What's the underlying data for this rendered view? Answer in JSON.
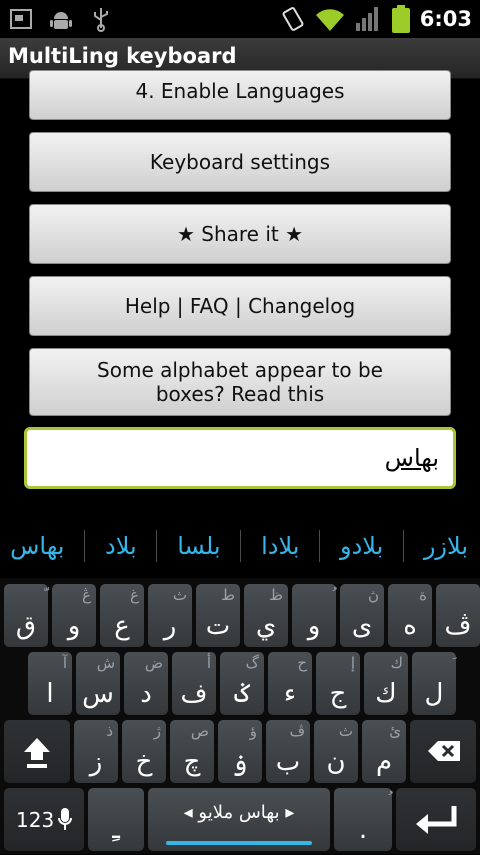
{
  "status": {
    "time": "6:03"
  },
  "app": {
    "title": "MultiLing keyboard"
  },
  "buttons": [
    "4. Enable Languages",
    "Keyboard settings",
    "★ Share it ★",
    "Help | FAQ | Changelog",
    "Some alphabet appear to be boxes? Read this"
  ],
  "input": {
    "value": "بهاس"
  },
  "candidates": [
    "بلازر",
    "بلادو",
    "بلادا",
    "بلسا",
    "بلاد",
    "بهاس"
  ],
  "keyboard": {
    "row1": [
      {
        "main": "ق",
        "sub": "ّ"
      },
      {
        "main": "و",
        "sub": "ڠ"
      },
      {
        "main": "ع",
        "sub": "غ"
      },
      {
        "main": "ر",
        "sub": "ث"
      },
      {
        "main": "ت",
        "sub": "ط"
      },
      {
        "main": "ي",
        "sub": "ظ"
      },
      {
        "main": "و",
        "sub": "ُ"
      },
      {
        "main": "ى",
        "sub": "ڽ"
      },
      {
        "main": "ه",
        "sub": "ة"
      },
      {
        "main": "ڤ",
        "sub": ""
      }
    ],
    "row2": [
      {
        "main": "ا",
        "sub": "آ"
      },
      {
        "main": "س",
        "sub": "ش"
      },
      {
        "main": "د",
        "sub": "ض"
      },
      {
        "main": "ف",
        "sub": "أ"
      },
      {
        "main": "ݢ",
        "sub": "گ"
      },
      {
        "main": "ء",
        "sub": "ح"
      },
      {
        "main": "ج",
        "sub": "إ"
      },
      {
        "main": "ك",
        "sub": "ك"
      },
      {
        "main": "ل",
        "sub": "َ"
      }
    ],
    "row3": [
      {
        "main": "ز",
        "sub": "ذ"
      },
      {
        "main": "خ",
        "sub": "ژ"
      },
      {
        "main": "چ",
        "sub": "ص"
      },
      {
        "main": "ۏ",
        "sub": "ؤ"
      },
      {
        "main": "ب",
        "sub": "ڤ"
      },
      {
        "main": "ن",
        "sub": "ث"
      },
      {
        "main": "م",
        "sub": "ئ"
      }
    ],
    "mode_label": "123",
    "dot_left": "ـِ",
    "space_label": "بهاس ملايو",
    "dot_right": ".",
    "dot_right_sub": "ُ"
  }
}
